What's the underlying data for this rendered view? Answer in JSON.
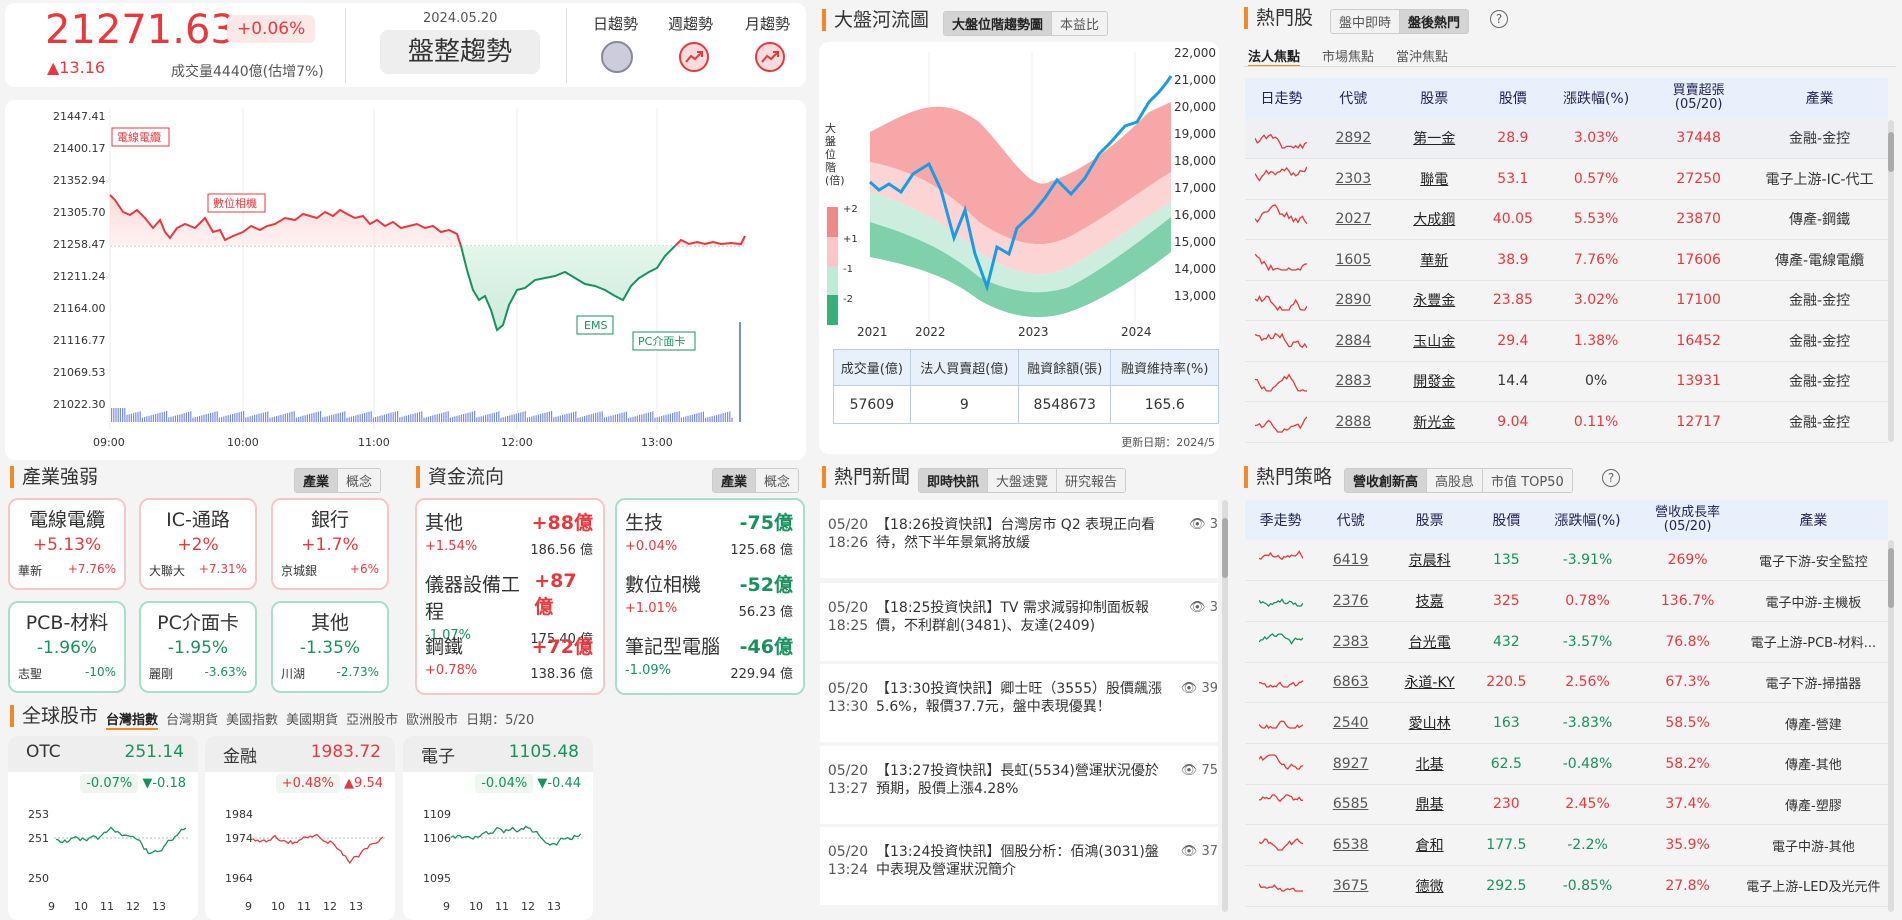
{
  "index": {
    "value": "21271.63",
    "pct": "+0.06%",
    "change": "▲13.16",
    "volume": "成交量4440億(估增7%)",
    "date": "2024.05.20",
    "trend_label": "盤整趨勢",
    "trend_labels": [
      "日趨勢",
      "週趨勢",
      "月趨勢"
    ]
  },
  "intraday": {
    "y_ticks": [
      "21447.41",
      "21400.17",
      "21352.94",
      "21305.70",
      "21258.47",
      "21211.24",
      "21164.00",
      "21116.77",
      "21069.53",
      "21022.30"
    ],
    "x_ticks": [
      "09:00",
      "10:00",
      "11:00",
      "12:00",
      "13:00"
    ],
    "annotations": [
      "電線電纜",
      "數位相機",
      "EMS",
      "PC介面卡"
    ]
  },
  "colors": {
    "up": "#e8383d",
    "down": "#18915d",
    "accent": "#f08a24",
    "header_blue": "#e8f1fb",
    "river_line": "#1a9be6"
  },
  "river": {
    "title": "大盤河流圖",
    "tabs": [
      "大盤位階趨勢圖",
      "本益比"
    ],
    "y_label": "大盤位階(倍)",
    "y_ticks": [
      "22,000",
      "21,000",
      "20,000",
      "19,000",
      "18,000",
      "17,000",
      "16,000",
      "15,000",
      "14,000",
      "13,000"
    ],
    "x_ticks": [
      "2021",
      "2022",
      "2023",
      "2024"
    ],
    "band_labels": [
      "+2",
      "+1",
      "-1",
      "-2"
    ],
    "stats_headers": [
      "成交量(億)",
      "法人買賣超(億)",
      "融資餘額(張)",
      "融資維持率(%)"
    ],
    "stats_values": [
      "57609",
      "9",
      "8548673",
      "165.6"
    ],
    "update": "更新日期：2024/5"
  },
  "hot": {
    "title": "熱門股",
    "seg": [
      "盤中即時",
      "盤後熱門"
    ],
    "tabs": [
      "法人焦點",
      "市場焦點",
      "當沖焦點"
    ],
    "headers": [
      "日走勢",
      "代號",
      "股票",
      "股價",
      "漲跌幅(%)",
      "買賣超張\n(05/20)",
      "產業"
    ],
    "rows": [
      [
        "2892",
        "第一金",
        "28.9",
        "3.03%",
        "37448",
        "金融-金控"
      ],
      [
        "2303",
        "聯電",
        "53.1",
        "0.57%",
        "27250",
        "電子上游-IC-代工"
      ],
      [
        "2027",
        "大成鋼",
        "40.05",
        "5.53%",
        "23870",
        "傳產-鋼鐵"
      ],
      [
        "1605",
        "華新",
        "38.9",
        "7.76%",
        "17606",
        "傳產-電線電纜"
      ],
      [
        "2890",
        "永豐金",
        "23.85",
        "3.02%",
        "17100",
        "金融-金控"
      ],
      [
        "2884",
        "玉山金",
        "29.4",
        "1.38%",
        "16452",
        "金融-金控"
      ],
      [
        "2883",
        "開發金",
        "14.4",
        "0%",
        "13931",
        "金融-金控"
      ],
      [
        "2888",
        "新光金",
        "9.04",
        "0.11%",
        "12717",
        "金融-金控"
      ]
    ]
  },
  "industry": {
    "title": "產業強弱",
    "seg": [
      "產業",
      "概念"
    ],
    "cards": [
      {
        "name": "電線電纜",
        "pct": "+5.13%",
        "stock": "華新",
        "spct": "+7.76%"
      },
      {
        "name": "IC-通路",
        "pct": "+2%",
        "stock": "大聯大",
        "spct": "+7.31%"
      },
      {
        "name": "銀行",
        "pct": "+1.7%",
        "stock": "京城銀",
        "spct": "+6%"
      },
      {
        "name": "PCB-材料",
        "pct": "-1.96%",
        "stock": "志聖",
        "spct": "-10%"
      },
      {
        "name": "PC介面卡",
        "pct": "-1.95%",
        "stock": "麗剛",
        "spct": "-3.63%"
      },
      {
        "name": "其他",
        "pct": "-1.35%",
        "stock": "川湖",
        "spct": "-2.73%"
      }
    ]
  },
  "fund": {
    "title": "資金流向",
    "seg": [
      "產業",
      "概念"
    ],
    "items": [
      {
        "name": "其他",
        "amt": "+88億",
        "pct": "+1.54%",
        "val": "186.56 億"
      },
      {
        "name": "儀器設備工程",
        "amt": "+87億",
        "pct": "-1.07%",
        "val": "175.40 億"
      },
      {
        "name": "鋼鐵",
        "amt": "+72億",
        "pct": "+0.78%",
        "val": "138.36 億"
      },
      {
        "name": "生技",
        "amt": "-75億",
        "pct": "+0.04%",
        "val": "125.68 億"
      },
      {
        "name": "數位相機",
        "amt": "-52億",
        "pct": "+1.01%",
        "val": "56.23 億"
      },
      {
        "name": "筆記型電腦",
        "amt": "-46億",
        "pct": "-1.09%",
        "val": "229.94 億"
      }
    ]
  },
  "global": {
    "title": "全球股市",
    "tabs": [
      "台灣指數",
      "台灣期貨",
      "美國指數",
      "美國期貨",
      "亞洲股市",
      "歐洲股市"
    ],
    "date": "日期：5/20",
    "minis": [
      {
        "name": "OTC",
        "val": "251.14",
        "pct": "-0.07%",
        "chg": "▼-0.18",
        "y": [
          "253",
          "251",
          "250"
        ]
      },
      {
        "name": "金融",
        "val": "1983.72",
        "pct": "+0.48%",
        "chg": "▲9.54",
        "y": [
          "1984",
          "1974",
          "1964"
        ]
      },
      {
        "name": "電子",
        "val": "1105.48",
        "pct": "-0.04%",
        "chg": "▼-0.44",
        "y": [
          "1109",
          "1106",
          "1095"
        ]
      }
    ],
    "x": [
      "9",
      "10",
      "11",
      "12",
      "13"
    ]
  },
  "news": {
    "title": "熱門新聞",
    "seg": [
      "即時快訊",
      "大盤速覽",
      "研究報告"
    ],
    "items": [
      {
        "d": "05/20",
        "t": "18:26",
        "txt": "【18:26投資快訊】台灣房市 Q2 表現正向看待，然下半年景氣將放緩",
        "v": "3"
      },
      {
        "d": "05/20",
        "t": "18:25",
        "txt": "【18:25投資快訊】TV 需求減弱抑制面板報價，不利群創(3481)、友達(2409)",
        "v": "3"
      },
      {
        "d": "05/20",
        "t": "13:30",
        "txt": "【13:30投資快訊】卿士旺（3555）股價飆漲5.6%，報價37.7元，盤中表現優異！",
        "v": "39"
      },
      {
        "d": "05/20",
        "t": "13:27",
        "txt": "【13:27投資快訊】長虹(5534)營運狀況優於預期，股價上漲4.28%",
        "v": "75"
      },
      {
        "d": "05/20",
        "t": "13:24",
        "txt": "【13:24投資快訊】個股分析：佰鴻(3031)盤中表現及營運狀況簡介",
        "v": "37"
      }
    ]
  },
  "strategy": {
    "title": "熱門策略",
    "seg": [
      "營收創新高",
      "高股息",
      "市值 TOP50"
    ],
    "headers": [
      "季走勢",
      "代號",
      "股票",
      "股價",
      "漲跌幅(%)",
      "營收成長率\n(05/20)",
      "產業"
    ],
    "rows": [
      [
        "6419",
        "京晨科",
        "135",
        "-3.91%",
        "269%",
        "電子下游-安全監控"
      ],
      [
        "2376",
        "技嘉",
        "325",
        "0.78%",
        "136.7%",
        "電子中游-主機板"
      ],
      [
        "2383",
        "台光電",
        "432",
        "-3.57%",
        "76.8%",
        "電子上游-PCB-材料..."
      ],
      [
        "6863",
        "永道-KY",
        "220.5",
        "2.56%",
        "67.3%",
        "電子下游-掃描器"
      ],
      [
        "2540",
        "愛山林",
        "163",
        "-3.83%",
        "58.5%",
        "傳產-營建"
      ],
      [
        "8927",
        "北基",
        "62.5",
        "-0.48%",
        "58.2%",
        "傳產-其他"
      ],
      [
        "6585",
        "鼎基",
        "230",
        "2.45%",
        "37.4%",
        "傳產-塑膠"
      ],
      [
        "6538",
        "倉和",
        "177.5",
        "-2.2%",
        "35.9%",
        "電子中游-其他"
      ],
      [
        "3675",
        "德微",
        "292.5",
        "-0.85%",
        "27.8%",
        "電子上游-LED及光元件"
      ]
    ]
  }
}
